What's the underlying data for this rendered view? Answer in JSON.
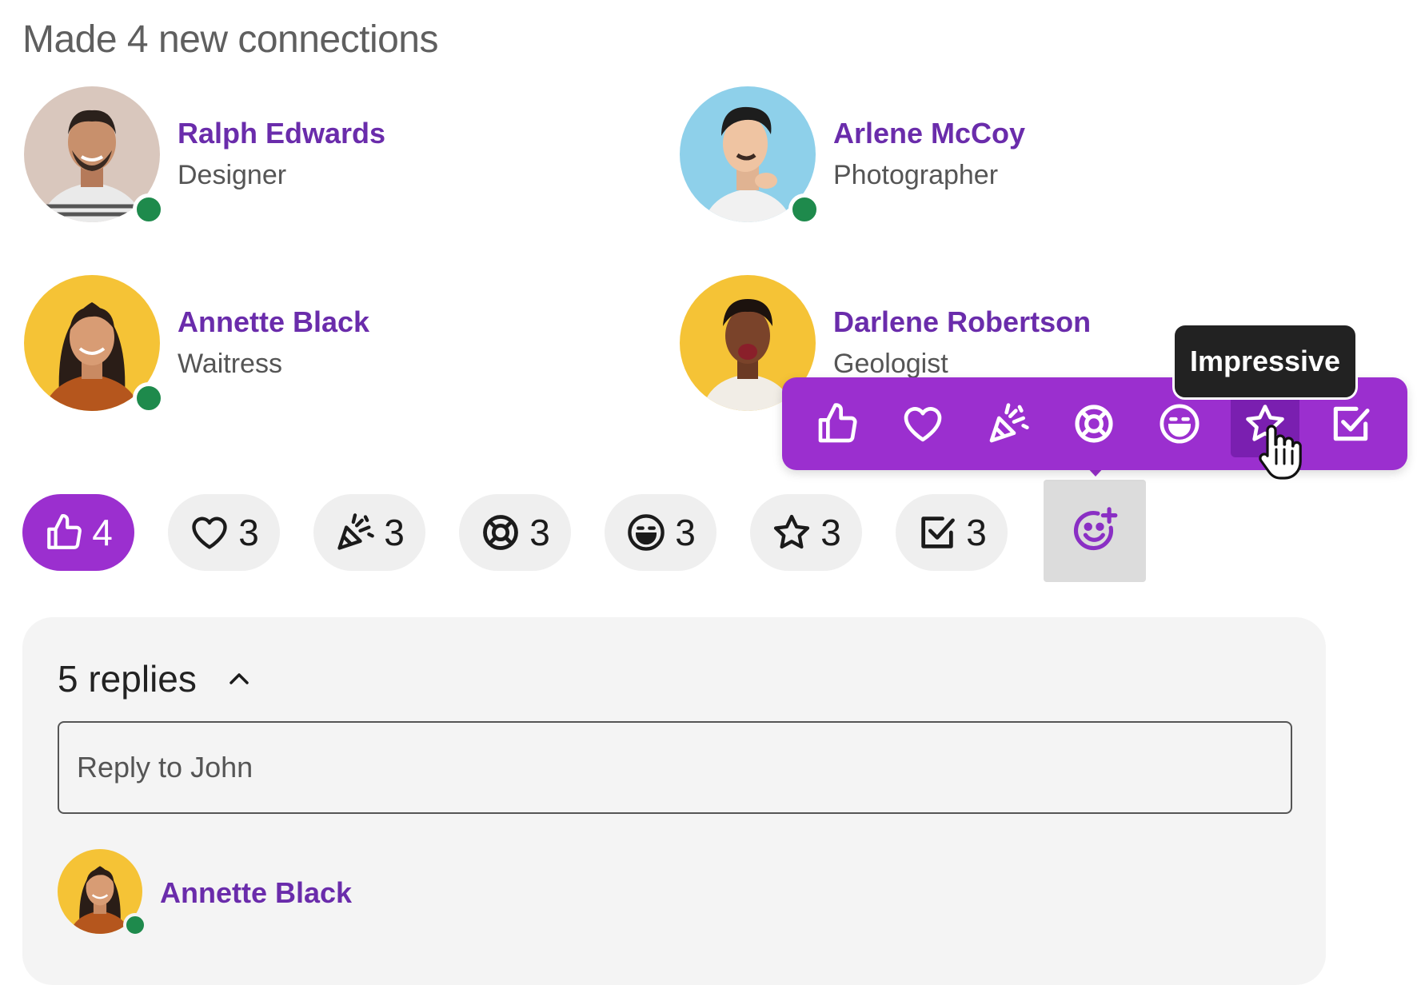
{
  "heading": "Made 4 new connections",
  "connections": [
    {
      "name": "Ralph Edwards",
      "role": "Designer",
      "online": true,
      "avatar_bg": "#d9c7bd"
    },
    {
      "name": "Arlene McCoy",
      "role": "Photographer",
      "online": true,
      "avatar_bg": "#8ed0ea"
    },
    {
      "name": "Annette Black",
      "role": "Waitress",
      "online": true,
      "avatar_bg": "#f5c336"
    },
    {
      "name": "Darlene Robertson",
      "role": "Geologist",
      "online": false,
      "avatar_bg": "#f5c336"
    }
  ],
  "reactions": [
    {
      "icon": "thumbs-up-icon",
      "count": "4",
      "active": true
    },
    {
      "icon": "heart-icon",
      "count": "3",
      "active": false
    },
    {
      "icon": "party-popper-icon",
      "count": "3",
      "active": false
    },
    {
      "icon": "lifebuoy-icon",
      "count": "3",
      "active": false
    },
    {
      "icon": "grinning-face-icon",
      "count": "3",
      "active": false
    },
    {
      "icon": "star-icon",
      "count": "3",
      "active": false
    },
    {
      "icon": "checkbox-icon",
      "count": "3",
      "active": false
    }
  ],
  "picker": {
    "options": [
      "thumbs-up-icon",
      "heart-icon",
      "party-popper-icon",
      "lifebuoy-icon",
      "grinning-face-icon",
      "star-icon",
      "checkbox-icon"
    ],
    "hovered": "star-icon",
    "tooltip": "Impressive"
  },
  "add_reaction_icon": "add-emoji-icon",
  "replies": {
    "count_label": "5 replies",
    "expanded": true,
    "input_placeholder": "Reply to John",
    "first_reply_author": "Annette Black"
  },
  "colors": {
    "accent": "#9b2fcf",
    "name": "#6a2cab",
    "online": "#1e8a4c",
    "chip_bg": "#efefef",
    "panel_bg": "#f4f4f4"
  }
}
